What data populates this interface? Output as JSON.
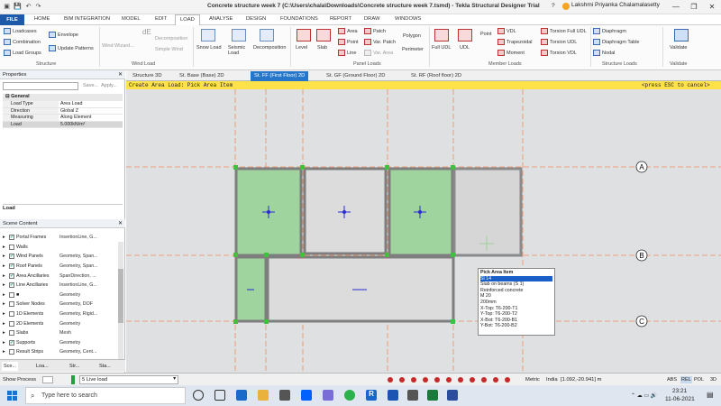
{
  "titlebar": {
    "title": "Concrete structure week 7 (C:\\Users\\chala\\Downloads\\Concrete structure week 7.tsmd) - Tekla Structural Designer Trial",
    "user": "Lakshmi Priyanka Chalamalasetty",
    "help": "?",
    "minimize": "—",
    "restore": "❐",
    "close": "✕"
  },
  "menu": [
    "FILE",
    "HOME",
    "BIM INTEGRATION",
    "MODEL",
    "EDIT",
    "LOAD",
    "ANALYSE",
    "DESIGN",
    "FOUNDATIONS",
    "REPORT",
    "DRAW",
    "WINDOWS"
  ],
  "ribbon": {
    "structure": {
      "loadcases": "Loadcases",
      "combination": "Combination",
      "load_groups": "Load Groups",
      "envelope": "Envelope",
      "update_patterns": "Update Patterns",
      "group": "Structure"
    },
    "wind": {
      "wizard": "Wind Wizard...",
      "decomposition": "Decomposition",
      "simple_wind": "Simple Wind",
      "group": "Wind Load"
    },
    "snow": "Snow Load",
    "seismic": "Seismic Load",
    "decomp": "Decomposition",
    "panel": {
      "level": "Level",
      "slab": "Slab",
      "area": "Area",
      "point": "Point",
      "line": "Line",
      "patch": "Patch",
      "var_patch": "Var. Patch",
      "var_area": "Var. Area",
      "polygon": "Polygon",
      "perimeter": "Perimeter",
      "group": "Panel Loads"
    },
    "member": {
      "full_udl": "Full UDL",
      "udl": "UDL",
      "point": "Point",
      "vdl": "VDL",
      "trapezoidal": "Trapezoidal",
      "moment": "Moment",
      "torsion_full_udl": "Torsion Full UDL",
      "torsion_udl": "Torsion UDL",
      "torsion_vdl": "Torsion VDL",
      "group": "Member Loads"
    },
    "struct_loads": {
      "diaphragm": "Diaphragm",
      "diaphragm_table": "Diaphragm Table",
      "nodal": "Nodal",
      "group": "Structure Loads"
    },
    "validate": {
      "label": "Validate",
      "group": "Validate"
    }
  },
  "properties": {
    "header": "Properties",
    "save_label": "Save...",
    "apply_label": "Apply...",
    "section": "General",
    "rows": [
      {
        "k": "Load Type",
        "v": "Area Load"
      },
      {
        "k": "Direction",
        "v": "Global Z"
      },
      {
        "k": "Measuring",
        "v": "Along Element"
      },
      {
        "k": "Load",
        "v": "5.000kN/m²"
      }
    ]
  },
  "load_panel": {
    "header": "Load"
  },
  "scene": {
    "header": "Scene Content",
    "rows": [
      {
        "n": "Portal Frames",
        "d": "InsertionLine, G...",
        "checked": true
      },
      {
        "n": "Walls",
        "d": "",
        "checked": false
      },
      {
        "n": "Wind Panels",
        "d": "Geometry, Span...",
        "checked": true
      },
      {
        "n": "Roof Panels",
        "d": "Geometry, Span...",
        "checked": true
      },
      {
        "n": "Area Ancillaries",
        "d": "SpanDirection, ...",
        "checked": true
      },
      {
        "n": "Line Ancillaries",
        "d": "InsertionLine, G...",
        "checked": true
      },
      {
        "n": "■",
        "d": "Geometry",
        "checked": false
      },
      {
        "n": "Solver Nodes",
        "d": "Geometry, DOF",
        "checked": false
      },
      {
        "n": "1D Elements",
        "d": "Geometry, Rigid...",
        "checked": false
      },
      {
        "n": "2D Elements",
        "d": "Geometry",
        "checked": false
      },
      {
        "n": "Slabs",
        "d": "Mesh",
        "checked": false
      },
      {
        "n": "Supports",
        "d": "Geometry",
        "checked": true
      },
      {
        "n": "Result Strips",
        "d": "Geometry, Cent...",
        "checked": false
      }
    ]
  },
  "bottom_tabs": [
    "Sce...",
    "Loa...",
    "Str...",
    "Sta..."
  ],
  "tabs": [
    "Structure 3D",
    "St. Base (Base) 2D",
    "St. FF (First Floor) 2D",
    "St. GF (Ground Floor) 2D",
    "St. RF (Roof floor) 2D"
  ],
  "cmdbar": {
    "prompt": "Create Area Load: Pick Area Item",
    "hint": "<press ESC to cancel>"
  },
  "grid_labels": [
    "A",
    "B",
    "C"
  ],
  "tooltip": {
    "title": "Pick Area Item",
    "lines": [
      "Sl 14",
      "Slab on beams (S 1)",
      "Reinforced concrete",
      "M 20",
      "200mm",
      "X-Top: T6-200-T1",
      "Y-Top: T6-200-T2",
      "X-Bot: T6-200-B1",
      "Y-Bot: T6-200-B2"
    ]
  },
  "status": {
    "show_process": "Show Process",
    "loadcase": "5 Live load",
    "units": "Metric",
    "country": "India",
    "coords": "[1.092,-20.941] m",
    "modes": [
      "ABS",
      "REL",
      "POL",
      "3D"
    ]
  },
  "taskbar": {
    "search": "Type here to search",
    "time": "23:21",
    "date": "11-06-2021"
  },
  "colors": {
    "accent": "#2677c9",
    "cmd": "#ffe14a",
    "loaded": "#9fd49f",
    "beam": "#7e7e7e",
    "node": "#3ec23e",
    "gridline": "#f08a5d"
  }
}
